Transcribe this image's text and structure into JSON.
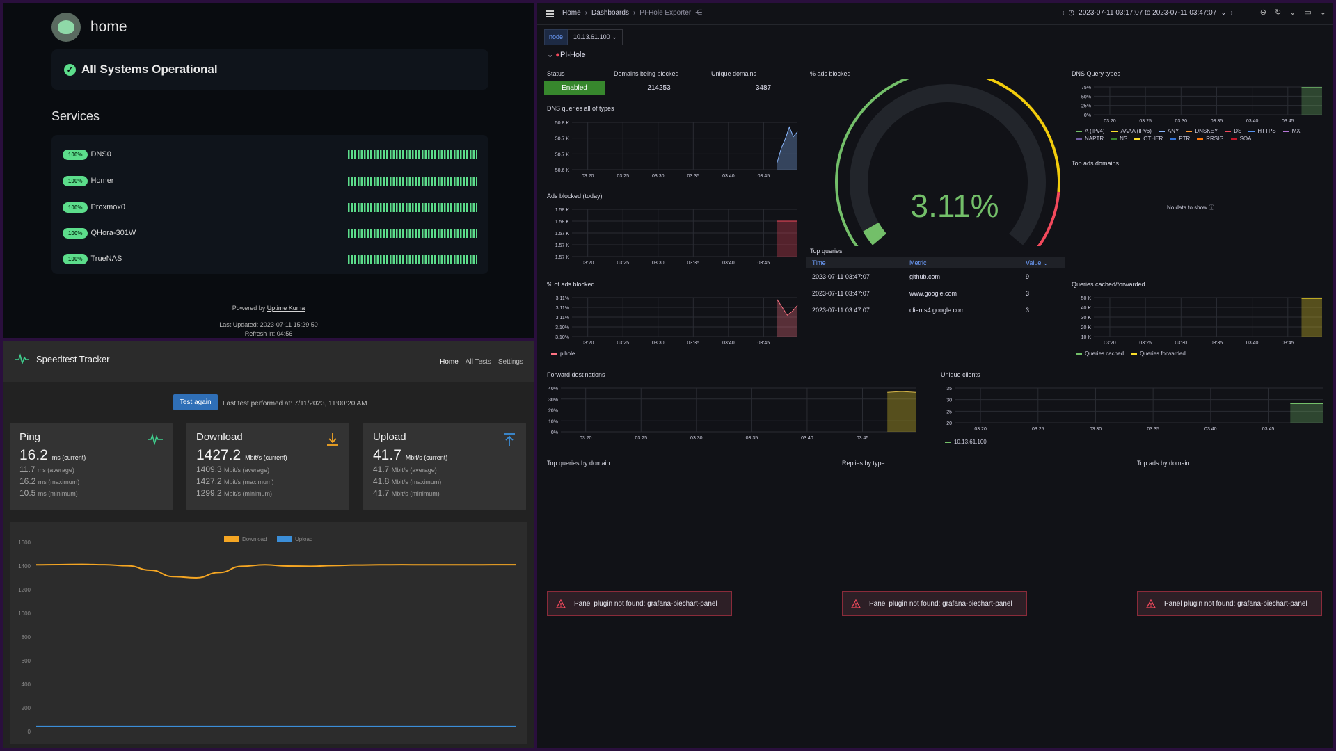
{
  "kuma": {
    "title": "home",
    "status_text": "All Systems Operational",
    "services_title": "Services",
    "services": [
      {
        "name": "DNS0",
        "uptime": "100%"
      },
      {
        "name": "Homer",
        "uptime": "100%"
      },
      {
        "name": "Proxmox0",
        "uptime": "100%"
      },
      {
        "name": "QHora-301W",
        "uptime": "100%"
      },
      {
        "name": "TrueNAS",
        "uptime": "100%"
      }
    ],
    "powered_by": "Powered by",
    "powered_link": "Uptime Kuma",
    "last_updated": "Last Updated: 2023-07-11 15:29:50",
    "refresh": "Refresh in: 04:56",
    "colors": {
      "accent": "#5cdd8b"
    }
  },
  "speedtest": {
    "brand": "Speedtest Tracker",
    "nav": [
      "Home",
      "All Tests",
      "Settings"
    ],
    "test_again": "Test again",
    "last_test": "Last test performed at: 7/11/2023, 11:00:20 AM",
    "cards": [
      {
        "title": "Ping",
        "icon": "pulse-icon",
        "current": "16.2",
        "current_unit": "ms (current)",
        "rows": [
          [
            "11.7",
            "ms (average)"
          ],
          [
            "16.2",
            "ms (maximum)"
          ],
          [
            "10.5",
            "ms (minimum)"
          ]
        ]
      },
      {
        "title": "Download",
        "icon": "download-arrow-icon",
        "current": "1427.2",
        "current_unit": "Mbit/s (current)",
        "rows": [
          [
            "1409.3",
            "Mbit/s (average)"
          ],
          [
            "1427.2",
            "Mbit/s (maximum)"
          ],
          [
            "1299.2",
            "Mbit/s (minimum)"
          ]
        ]
      },
      {
        "title": "Upload",
        "icon": "upload-arrow-icon",
        "current": "41.7",
        "current_unit": "Mbit/s (current)",
        "rows": [
          [
            "41.7",
            "Mbit/s (average)"
          ],
          [
            "41.8",
            "Mbit/s (maximum)"
          ],
          [
            "41.7",
            "Mbit/s (minimum)"
          ]
        ]
      }
    ],
    "chart": {
      "legend": [
        "Download",
        "Upload"
      ],
      "yticks": [
        0,
        200,
        400,
        600,
        800,
        1000,
        1200,
        1400,
        1600
      ],
      "download": [
        1410,
        1412,
        1414,
        1411,
        1402,
        1365,
        1310,
        1300,
        1345,
        1398,
        1410,
        1400,
        1398,
        1404,
        1408,
        1410,
        1411,
        1410,
        1410,
        1410,
        1411,
        1411
      ],
      "upload": [
        42,
        42,
        42,
        42,
        42,
        42,
        42,
        42,
        42,
        42,
        42,
        42,
        42,
        42,
        42,
        42,
        42,
        42,
        42,
        42,
        42,
        42
      ],
      "colors": {
        "download": "#f5a623",
        "upload": "#3b8ed8"
      }
    }
  },
  "grafana": {
    "breadcrumbs": [
      "Home",
      "Dashboards",
      "PI-Hole Exporter"
    ],
    "time_range": "2023-07-11 03:17:07 to 2023-07-11 03:47:07",
    "variable_label": "node",
    "variable_value": "10.13.61.100",
    "row_title": "PI-Hole",
    "stats": {
      "status_title": "Status",
      "status_value": "Enabled",
      "blocked_title": "Domains being blocked",
      "blocked_value": "214253",
      "unique_title": "Unique domains",
      "unique_value": "3487"
    },
    "panels": {
      "dns_queries": "DNS queries all of types",
      "ads_blocked_today": "Ads blocked (today)",
      "pct_ads_blocked": "% of ads blocked",
      "gauge_title": "% ads blocked",
      "dns_query_types": "DNS Query types",
      "top_ads_domains": "Top ads domains",
      "top_queries": "Top queries",
      "queries_cached": "Queries cached/forwarded",
      "forward_destinations": "Forward destinations",
      "unique_clients": "Unique clients",
      "top_queries_by_domain": "Top queries by domain",
      "replies_by_type": "Replies by type",
      "top_ads_by_domain": "Top ads by domain"
    },
    "gauge_value": "3.11%",
    "gauge_fraction": 0.03,
    "xticks": [
      "03:20",
      "03:25",
      "03:30",
      "03:35",
      "03:40",
      "03:45"
    ],
    "dns_yticks": [
      "50.8 K",
      "50.7 K",
      "50.7 K",
      "50.6 K"
    ],
    "ads_yticks": [
      "1.58 K",
      "1.58 K",
      "1.57 K",
      "1.57 K",
      "1.57 K"
    ],
    "pct_yticks": [
      "3.11%",
      "3.11%",
      "3.11%",
      "3.10%",
      "3.10%"
    ],
    "pct_legend": "pihole",
    "qtype_yticks": [
      "75%",
      "50%",
      "25%",
      "0%"
    ],
    "qtype_legend": [
      "A (IPv4)",
      "AAAA (IPv6)",
      "ANY",
      "DNSKEY",
      "DS",
      "HTTPS",
      "MX",
      "NAPTR",
      "NS",
      "OTHER",
      "PTR",
      "RRSIG",
      "SOA"
    ],
    "qtype_colors": [
      "#73bf69",
      "#fade2a",
      "#8ab8ff",
      "#ff9830",
      "#f2495c",
      "#5794f2",
      "#b877d9",
      "#705da0",
      "#37872d",
      "#fade2a",
      "#3274d9",
      "#ff780a",
      "#c4162a"
    ],
    "no_data": "No data to show",
    "cached_yticks": [
      "50 K",
      "40 K",
      "30 K",
      "20 K",
      "10 K"
    ],
    "cached_legend": [
      "Queries cached",
      "Queries forwarded"
    ],
    "forward_yticks": [
      "40%",
      "30%",
      "20%",
      "10%",
      "0%"
    ],
    "clients_yticks": [
      "35",
      "30",
      "25",
      "20"
    ],
    "clients_legend": "10.13.61.100",
    "table": {
      "headers": [
        "Time",
        "Metric",
        "Value"
      ],
      "rows": [
        [
          "2023-07-11 03:47:07",
          "github.com",
          "9"
        ],
        [
          "2023-07-11 03:47:07",
          "www.google.com",
          "3"
        ],
        [
          "2023-07-11 03:47:07",
          "clients4.google.com",
          "3"
        ]
      ]
    },
    "error_text": "Panel plugin not found: grafana-piechart-panel"
  }
}
